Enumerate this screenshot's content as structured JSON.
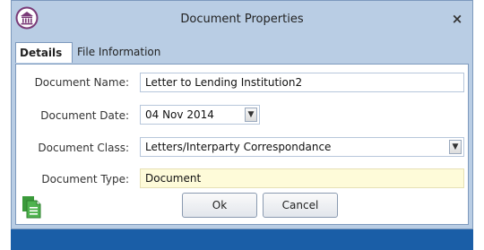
{
  "window": {
    "title": "Document Properties",
    "close_glyph": "×"
  },
  "tabs": [
    {
      "label": "Details",
      "active": true
    },
    {
      "label": "File Information",
      "active": false
    }
  ],
  "form": {
    "name": {
      "label": "Document Name:",
      "value": "Letter to Lending Institution2"
    },
    "date": {
      "label": "Document Date:",
      "value": "04 Nov 2014"
    },
    "class": {
      "label": "Document Class:",
      "value": "Letters/Interparty Correspondance"
    },
    "type": {
      "label": "Document Type:",
      "value": "Document"
    }
  },
  "buttons": {
    "ok": "Ok",
    "cancel": "Cancel"
  },
  "icons": {
    "logo": "columns-building-icon",
    "document": "document-copy-icon",
    "dropdown": "chevron-down-icon"
  },
  "colors": {
    "dialog_bg": "#b9cde4",
    "backdrop": "#1a5ea7",
    "readonly_field": "#fefbd9",
    "logo": "#7a3b78",
    "doc_icon": "#3a9a3a"
  }
}
